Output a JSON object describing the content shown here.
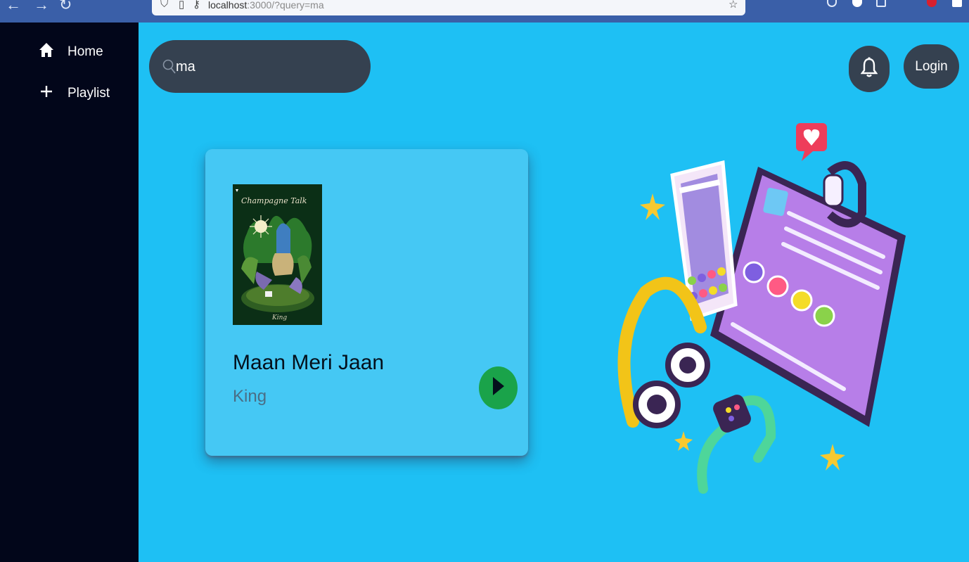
{
  "browser": {
    "url_host": "localhost",
    "url_rest": ":3000/?query=ma"
  },
  "sidebar": {
    "items": [
      {
        "label": "Home",
        "icon": "home-icon"
      },
      {
        "label": "Playlist",
        "icon": "plus-icon"
      }
    ]
  },
  "search": {
    "value": "ma"
  },
  "header": {
    "login_label": "Login",
    "notification_icon": "bell-icon"
  },
  "results": [
    {
      "title": "Maan Meri Jaan",
      "artist": "King",
      "cover_text": "Champagne Talk",
      "cover_signature": "King"
    }
  ],
  "colors": {
    "background": "#1ec0f4",
    "sidebar": "#02061a",
    "card": "#45c8f4",
    "control": "#354150",
    "play_button": "#1aa34a"
  }
}
